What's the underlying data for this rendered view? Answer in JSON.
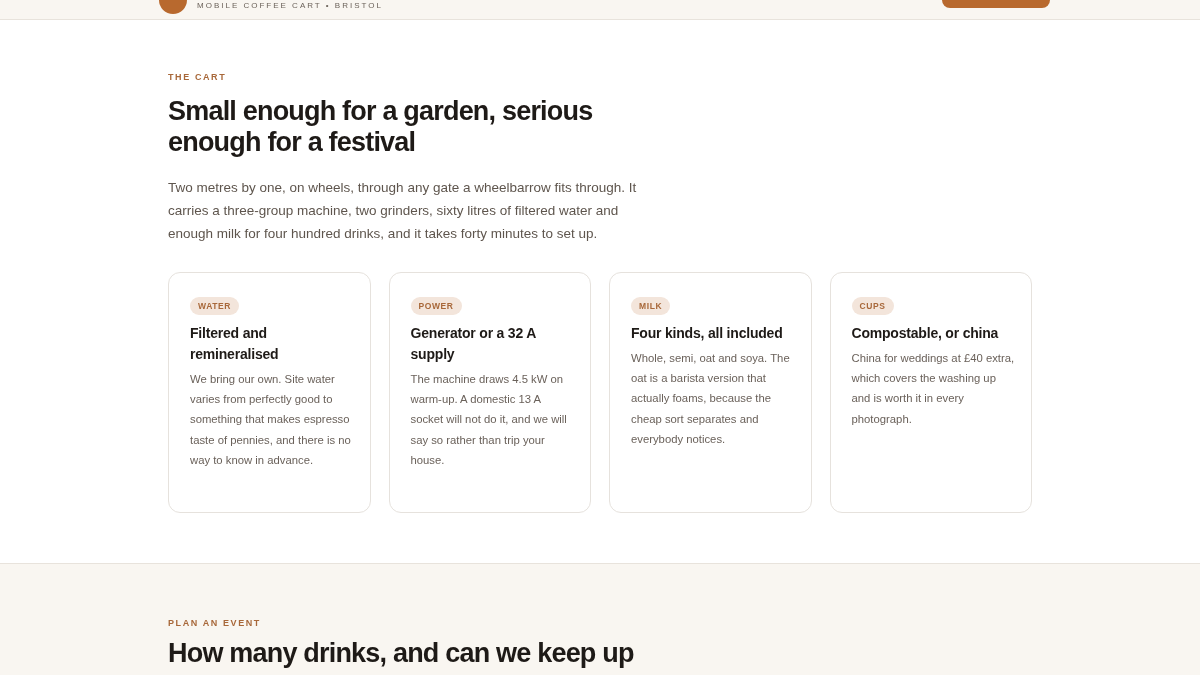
{
  "header": {
    "tagline": "MOBILE COFFEE CART • BRISTOL"
  },
  "cart_section": {
    "eyebrow": "THE CART",
    "title": "Small enough for a garden, serious enough for a festival",
    "intro": "Two metres by one, on wheels, through any gate a wheelbarrow fits through. It carries a three-group machine, two grinders, sixty litres of filtered water and enough milk for four hundred drinks, and it takes forty minutes to set up.",
    "cards": [
      {
        "tag": "WATER",
        "title": "Filtered and remineralised",
        "text": "We bring our own. Site water varies from perfectly good to something that makes espresso taste of pennies, and there is no way to know in advance."
      },
      {
        "tag": "POWER",
        "title": "Generator or a 32 A supply",
        "text": "The machine draws 4.5 kW on warm-up. A domestic 13 A socket will not do it, and we will say so rather than trip your house."
      },
      {
        "tag": "MILK",
        "title": "Four kinds, all included",
        "text": "Whole, semi, oat and soya. The oat is a barista version that actually foams, because the cheap sort separates and everybody notices."
      },
      {
        "tag": "CUPS",
        "title": "Compostable, or china",
        "text": "China for weddings at £40 extra, which covers the washing up and is worth it in every photograph."
      }
    ]
  },
  "event_section": {
    "eyebrow": "PLAN AN EVENT",
    "title": "How many drinks, and can we keep up"
  }
}
